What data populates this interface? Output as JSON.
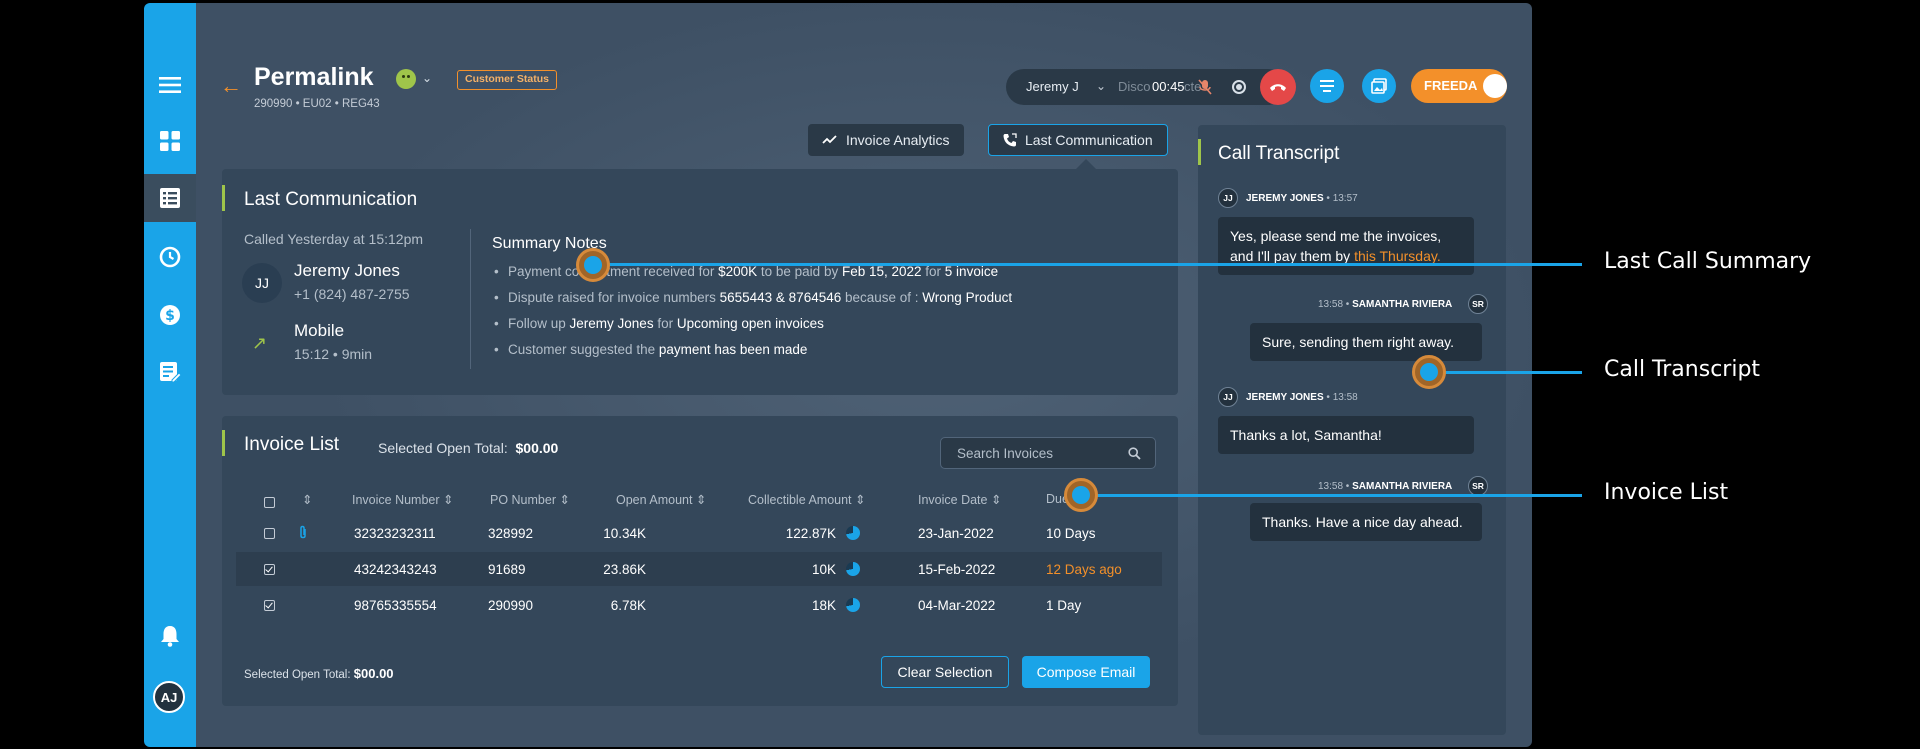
{
  "header": {
    "title": "Permalink",
    "subtitle": "290990 • EU02 • REG43",
    "status_badge": "Customer Status"
  },
  "callbar": {
    "agent": "Jeremy J",
    "disconnect_text": "Disco",
    "disconnect_tail": "cte",
    "timer": "00:45",
    "freeda": "FREEDA"
  },
  "tabs": [
    {
      "label": "Invoice Analytics"
    },
    {
      "label": "Last Communication"
    }
  ],
  "last_communication": {
    "title": "Last Communication",
    "called": "Called Yesterday at 15:12pm",
    "avatar": "JJ",
    "name": "Jeremy Jones",
    "phone": "+1 (824) 487-2755",
    "channel": "Mobile",
    "duration": "15:12 • 9min",
    "notes_title": "Summary Notes",
    "notes": {
      "n1_a": "Payment co",
      "n1_b": "itment received for ",
      "n1_amount": "$200K",
      "n1_c": " to be paid by ",
      "n1_date": "Feb 15, 2022",
      "n1_d": " for ",
      "n1_count": "5 invoice",
      "n2_a": "Dispute raised for invoice numbers ",
      "n2_nums": "5655443 & 8764546",
      "n2_b": " because of : ",
      "n2_reason": "Wrong Product",
      "n3_a": "Follow up ",
      "n3_name": "Jeremy Jones",
      "n3_b": " for ",
      "n3_c": "Upcoming open invoices",
      "n4_a": "Customer suggested the ",
      "n4_b": "payment has been made"
    }
  },
  "invoice_list": {
    "title": "Invoice List",
    "selected_label": "Selected Open Total:",
    "selected_value": "$00.00",
    "search_placeholder": "Search Invoices",
    "columns": {
      "invoice_number": "Invoice Number",
      "po_number": "PO Number",
      "open_amount": "Open Amount",
      "collectible_amount": "Collectible Amount",
      "invoice_date": "Invoice Date",
      "due": "Due"
    },
    "rows": [
      {
        "invoice": "32323232311",
        "po": "328992",
        "open": "10.34K",
        "collectible": "122.87K",
        "date": "23-Jan-2022",
        "due": "10 Days"
      },
      {
        "invoice": "43242343243",
        "po": "91689",
        "open": "23.86K",
        "collectible": "10K",
        "date": "15-Feb-2022",
        "due": "12 Days ago"
      },
      {
        "invoice": "98765335554",
        "po": "290990",
        "open": "6.78K",
        "collectible": "18K",
        "date": "04-Mar-2022",
        "due": "1 Day"
      }
    ],
    "footer_label": "Selected Open Total:",
    "footer_value": "$00.00",
    "clear_button": "Clear Selection",
    "compose_button": "Compose Email"
  },
  "transcript": {
    "title": "Call Transcript",
    "messages": [
      {
        "initials": "JJ",
        "name": "JEREMY JONES",
        "time": "13:57",
        "text_a": "Yes, please send me the invoices, and I'll pay them by ",
        "text_hl": "this Thursday."
      },
      {
        "initials": "SR",
        "name": "SAMANTHA RIVIERA",
        "time": "13:58",
        "text": "Sure, sending them right away."
      },
      {
        "initials": "JJ",
        "name": "JEREMY JONES",
        "time": "13:58",
        "text": "Thanks a lot, Samantha!"
      },
      {
        "initials": "SR",
        "name": "SAMANTHA RIVIERA",
        "time": "13:58",
        "text": "Thanks. Have a nice day ahead."
      }
    ]
  },
  "sidebar": {
    "avatar": "AJ"
  },
  "annotations": [
    {
      "label": "Last Call Summary"
    },
    {
      "label": "Call Transcript"
    },
    {
      "label": "Invoice List"
    }
  ],
  "colors": {
    "accent": "#1aa4e8",
    "orange": "#f3902a",
    "green": "#9fc54a",
    "danger": "#e44848"
  }
}
